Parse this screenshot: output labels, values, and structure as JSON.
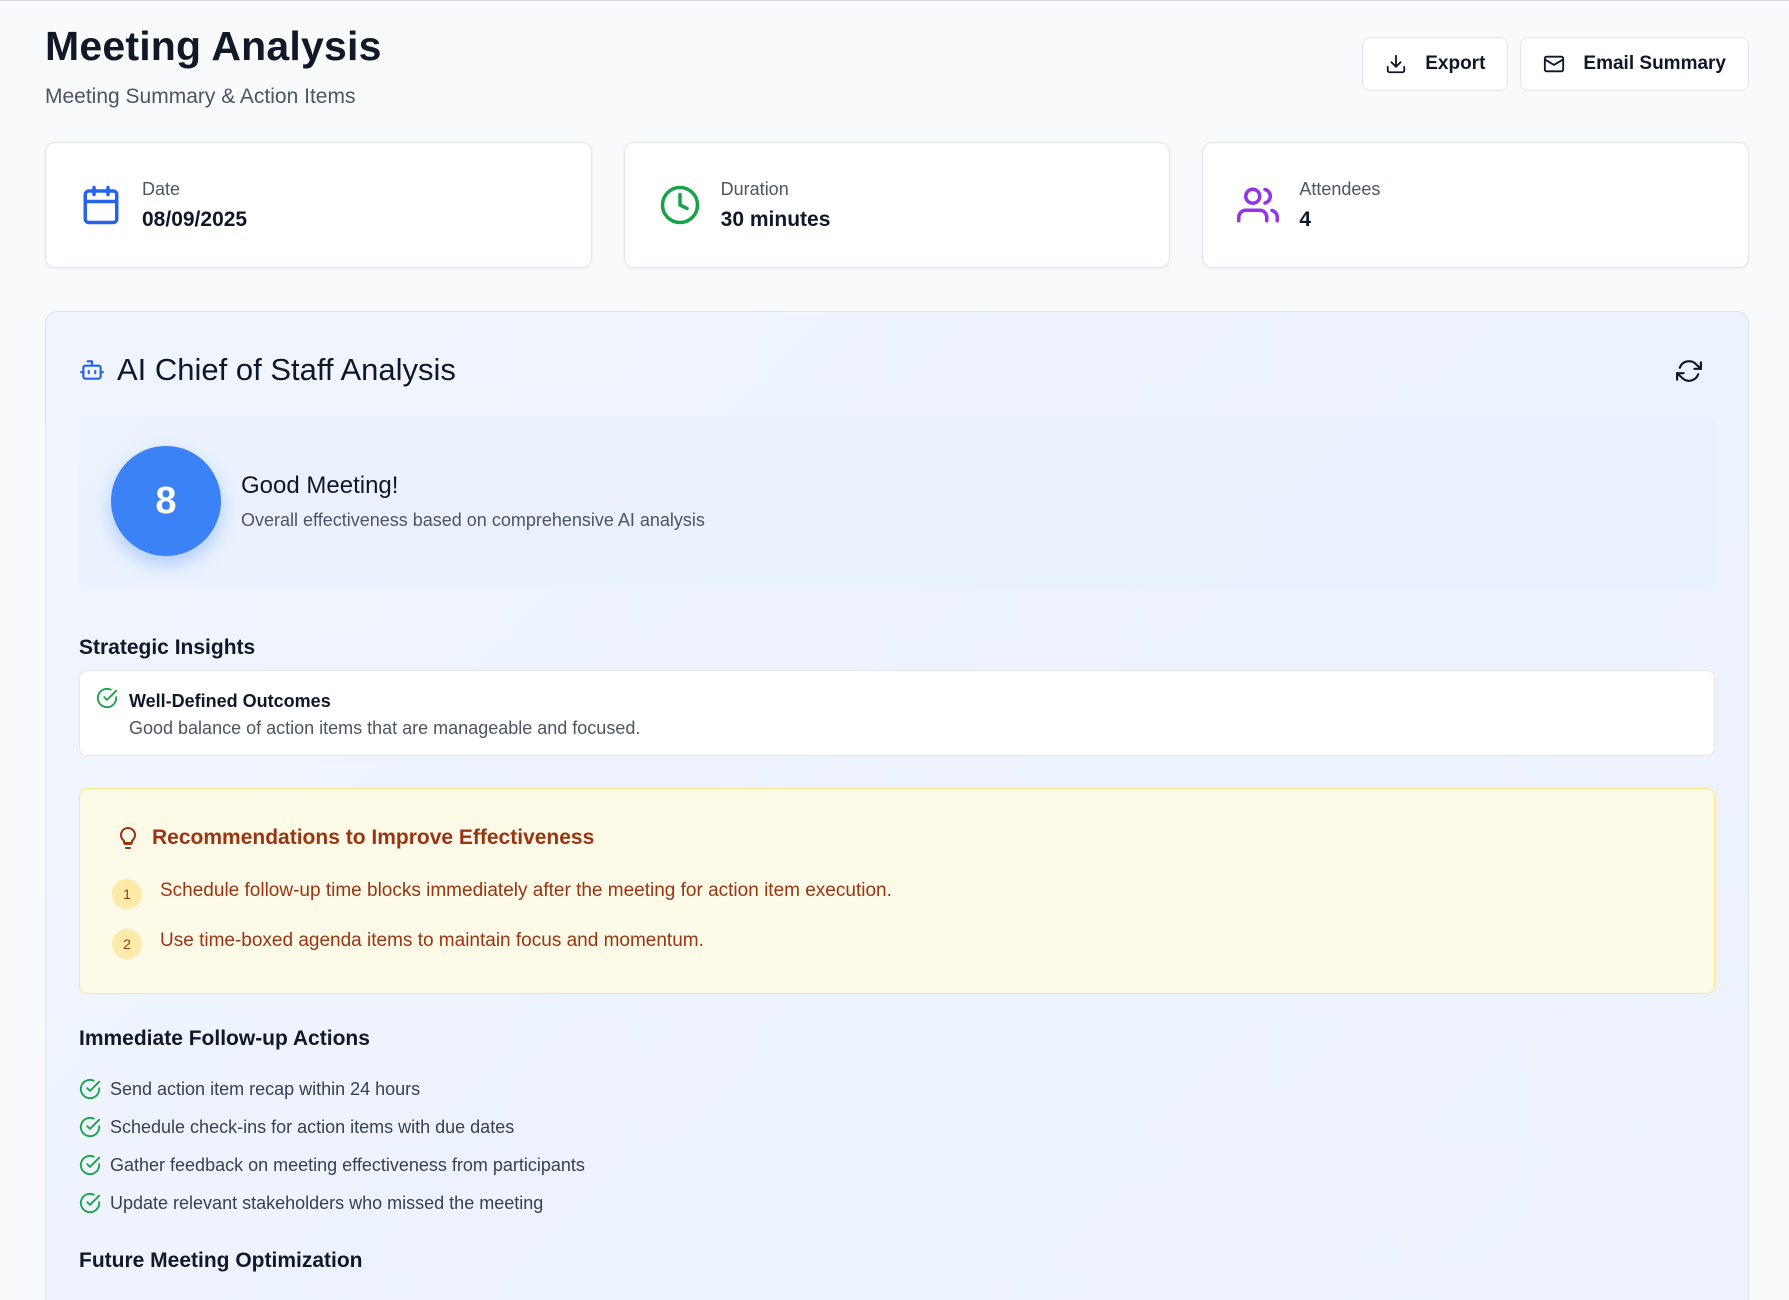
{
  "header": {
    "title": "Meeting Analysis",
    "subtitle": "Meeting Summary & Action Items",
    "actions": {
      "export_label": "Export",
      "email_label": "Email Summary"
    }
  },
  "stats": [
    {
      "label": "Date",
      "value": "08/09/2025",
      "icon": "calendar-icon",
      "color": "#2563eb"
    },
    {
      "label": "Duration",
      "value": "30 minutes",
      "icon": "clock-icon",
      "color": "#16a34a"
    },
    {
      "label": "Attendees",
      "value": "4",
      "icon": "users-icon",
      "color": "#9333ea"
    }
  ],
  "analysis": {
    "title": "AI Chief of Staff Analysis",
    "score": {
      "value": "8",
      "title": "Good Meeting!",
      "description": "Overall effectiveness based on comprehensive AI analysis"
    },
    "strategic_insights": {
      "title": "Strategic Insights",
      "items": [
        {
          "title": "Well-Defined Outcomes",
          "description": "Good balance of action items that are manageable and focused."
        }
      ]
    },
    "recommendations": {
      "title": "Recommendations to Improve Effectiveness",
      "items": [
        {
          "num": "1",
          "text": "Schedule follow-up time blocks immediately after the meeting for action item execution."
        },
        {
          "num": "2",
          "text": "Use time-boxed agenda items to maintain focus and momentum."
        }
      ]
    },
    "follow_up": {
      "title": "Immediate Follow-up Actions",
      "items": [
        "Send action item recap within 24 hours",
        "Schedule check-ins for action items with due dates",
        "Gather feedback on meeting effectiveness from participants",
        "Update relevant stakeholders who missed the meeting"
      ]
    },
    "future_optimization": {
      "title": "Future Meeting Optimization"
    }
  },
  "colors": {
    "primary": "#3b82f6",
    "success": "#16a34a",
    "warning_bg": "#fefae8",
    "warning_text": "#9a3412"
  }
}
